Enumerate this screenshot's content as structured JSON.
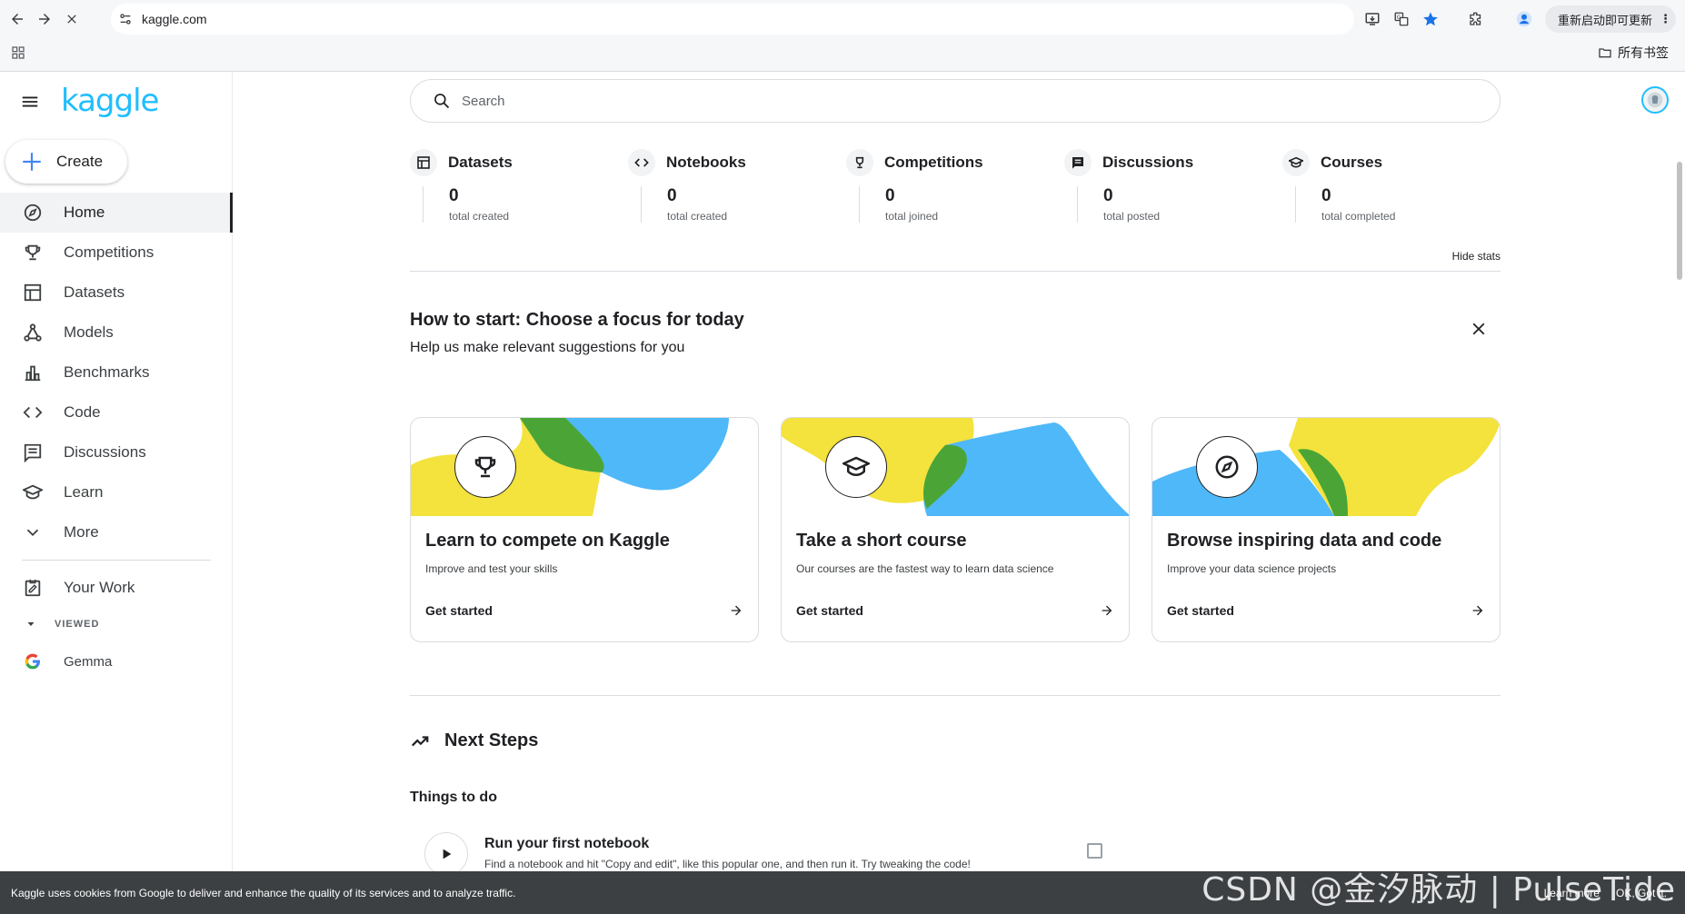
{
  "browser": {
    "url": "kaggle.com",
    "update_label": "重新启动即可更新",
    "update_menu": "⋮",
    "bookmarks_label": "所有书签"
  },
  "sidebar": {
    "logo": "kaggle",
    "create_label": "Create",
    "items": [
      {
        "label": "Home",
        "icon": "compass-icon"
      },
      {
        "label": "Competitions",
        "icon": "trophy-icon"
      },
      {
        "label": "Datasets",
        "icon": "table-icon"
      },
      {
        "label": "Models",
        "icon": "models-icon"
      },
      {
        "label": "Benchmarks",
        "icon": "bar-chart-icon"
      },
      {
        "label": "Code",
        "icon": "code-icon"
      },
      {
        "label": "Discussions",
        "icon": "discussion-icon"
      },
      {
        "label": "Learn",
        "icon": "school-icon"
      },
      {
        "label": "More",
        "icon": "chevron-down-icon"
      }
    ],
    "your_work": "Your Work",
    "viewed_label": "VIEWED",
    "viewed_items": [
      {
        "label": "Gemma"
      }
    ]
  },
  "search": {
    "placeholder": "Search"
  },
  "stats": {
    "items": [
      {
        "title": "Datasets",
        "value": "0",
        "sub": "total created"
      },
      {
        "title": "Notebooks",
        "value": "0",
        "sub": "total created"
      },
      {
        "title": "Competitions",
        "value": "0",
        "sub": "total joined"
      },
      {
        "title": "Discussions",
        "value": "0",
        "sub": "total posted"
      },
      {
        "title": "Courses",
        "value": "0",
        "sub": "total completed"
      }
    ],
    "hide_label": "Hide stats"
  },
  "focus": {
    "title": "How to start: Choose a focus for today",
    "subtitle": "Help us make relevant suggestions for you"
  },
  "cards": [
    {
      "title": "Learn to compete on Kaggle",
      "desc": "Improve and test your skills",
      "cta": "Get started",
      "colors": [
        "#f4e23d",
        "#4aa536",
        "#4fb8f8"
      ]
    },
    {
      "title": "Take a short course",
      "desc": "Our courses are the fastest way to learn data science",
      "cta": "Get started",
      "colors": [
        "#f4e23d",
        "#4aa536",
        "#4fb8f8"
      ]
    },
    {
      "title": "Browse inspiring data and code",
      "desc": "Improve your data science projects",
      "cta": "Get started",
      "colors": [
        "#f4e23d",
        "#4aa536",
        "#4fb8f8"
      ]
    }
  ],
  "next_steps": {
    "title": "Next Steps",
    "things_title": "Things to do",
    "todo": [
      {
        "title": "Run your first notebook",
        "desc": "Find a notebook and hit \"Copy and edit\", like this popular one, and then run it. Try tweaking the code!"
      }
    ]
  },
  "cookie": {
    "text": "Kaggle uses cookies from Google to deliver and enhance the quality of its services and to analyze traffic.",
    "learn_more": "Learn more",
    "ok": "OK, Got it."
  },
  "watermark": "CSDN @金汐脉动 | PulseTide",
  "theme": {
    "accent": "#20beff",
    "text": "#202124"
  }
}
